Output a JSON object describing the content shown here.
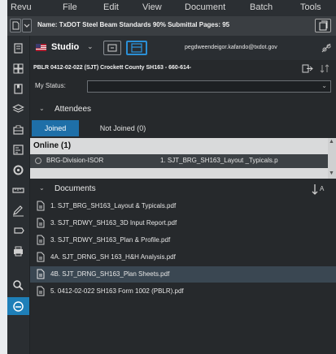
{
  "menu": [
    "Revu",
    "File",
    "Edit",
    "View",
    "Document",
    "Batch",
    "Tools"
  ],
  "infobar": {
    "name_label": "Name:",
    "name_value": "TxDOT Steel Beam Standards 90% Submittal",
    "pages_label": "Pages:",
    "pages_value": "95"
  },
  "studio": {
    "label": "Studio",
    "email": "pegdweendeigor.kafando@txdot.gov"
  },
  "session": {
    "title": "PBLR 0412-02-022 (SJT) Crockett County SH163 - 660-614-"
  },
  "status": {
    "label": "My Status:",
    "value": ""
  },
  "attendees": {
    "title": "Attendees",
    "tabs": [
      "Joined",
      "Not Joined (0)"
    ],
    "online_label": "Online (1)",
    "rows": [
      {
        "name": "BRG-Division-ISOR",
        "document": "1. SJT_BRG_SH163_Layout _Typicals.p"
      }
    ]
  },
  "documents": {
    "title": "Documents",
    "items": [
      {
        "name": "1. SJT_BRG_SH163_Layout & Typicals.pdf",
        "selected": false
      },
      {
        "name": "3. SJT_RDWY_SH163_3D Input Report.pdf",
        "selected": false
      },
      {
        "name": "3. SJT_RDWY_SH163_Plan & Profile.pdf",
        "selected": false
      },
      {
        "name": "4A. SJT_DRNG_SH 163_H&H Analysis.pdf",
        "selected": false
      },
      {
        "name": "4B. SJT_DRNG_SH163_Plan Sheets.pdf",
        "selected": true
      },
      {
        "name": "5. 0412-02-022 SH163 Form 1002 (PBLR).pdf",
        "selected": false
      }
    ]
  },
  "colors": {
    "accent": "#1e7fb8",
    "tab_active": "#1e6fa8",
    "selected_row": "#3a4752"
  },
  "left_toolbar_icons": [
    "pages-icon",
    "thumbnails-icon",
    "bookmarks-icon",
    "layers-icon",
    "toolchest-icon",
    "forms-icon",
    "settings-icon",
    "measure-icon",
    "signatures-icon",
    "shapes-icon",
    "print-icon",
    "search-icon",
    "studio-icon"
  ]
}
